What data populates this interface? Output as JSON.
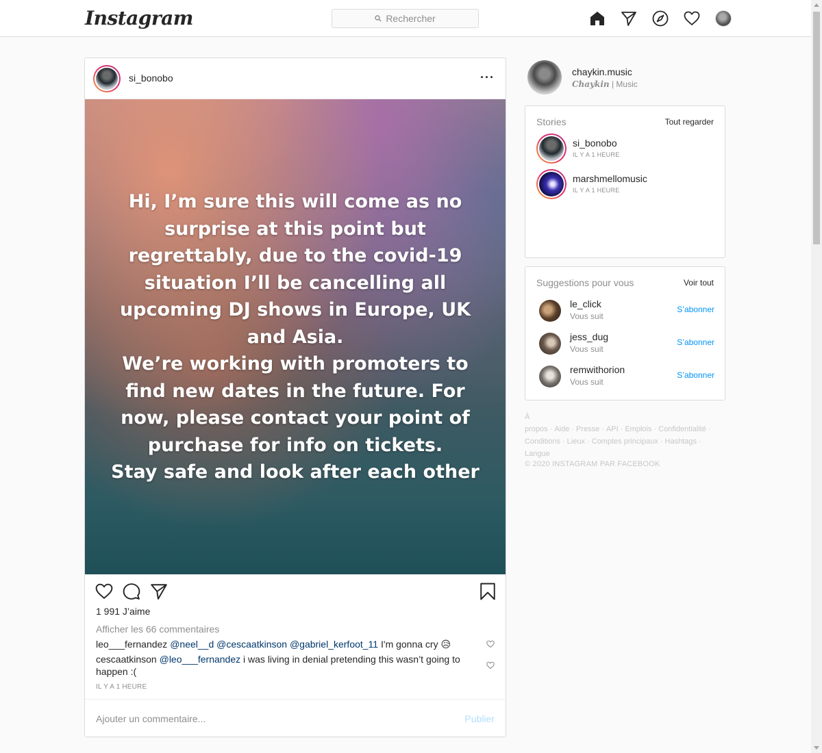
{
  "nav": {
    "logo": "Instagram",
    "search_placeholder": "Rechercher",
    "icons": [
      "home-icon",
      "direct-icon",
      "explore-icon",
      "activity-heart-icon",
      "profile-avatar"
    ]
  },
  "post": {
    "username": "si_bonobo",
    "image_text": "Hi, I’m sure this will come as no\nsurprise at this point but\nregrettably, due to the covid-19\nsituation I’ll be cancelling all\nupcoming DJ shows in Europe, UK\nand Asia.\nWe’re working with promoters to\nfind new dates in the future. For\nnow, please contact your point of\npurchase for info on tickets.\nStay safe and look after each other",
    "likes": "1 991 J’aime",
    "view_comments": "Afficher les 66 commentaires",
    "comments": [
      {
        "user": "leo___fernandez",
        "mentions": "@neel__d @cescaatkinson @gabriel_kerfoot_11",
        "text": "I'm gonna cry 😥"
      },
      {
        "user": "cescaatkinson",
        "mentions": "@leo___fernandez",
        "text": "i was living in denial pretending this wasn’t going to happen :("
      }
    ],
    "time": "IL Y A 1 HEURE",
    "add_comment_placeholder": "Ajouter un commentaire...",
    "publish_label": "Publier"
  },
  "me": {
    "username": "chaykin.music",
    "full_name": "Chaykin",
    "bio_suffix": " | Music"
  },
  "stories": {
    "title": "Stories",
    "see_all": "Tout regarder",
    "items": [
      {
        "user": "si_bonobo",
        "time": "IL Y A 1 HEURE"
      },
      {
        "user": "marshmellomusic",
        "time": "IL Y A 1 HEURE"
      }
    ]
  },
  "suggestions": {
    "title": "Suggestions pour vous",
    "see_all": "Voir tout",
    "items": [
      {
        "user": "le_click",
        "sub": "Vous suit",
        "action": "S’abonner"
      },
      {
        "user": "jess_dug",
        "sub": "Vous suit",
        "action": "S’abonner"
      },
      {
        "user": "remwithorion",
        "sub": "Vous suit",
        "action": "S’abonner"
      }
    ]
  },
  "footer": {
    "links": [
      "À propos",
      "Aide",
      "Presse",
      "API",
      "Emplois",
      "Confidentialité",
      "Conditions",
      "Lieux",
      "Comptes principaux",
      "Hashtags",
      "Langue"
    ],
    "copyright": "© 2020 INSTAGRAM PAR FACEBOOK"
  },
  "colors": {
    "link_blue": "#0095f6",
    "publish_disabled": "#b2dffc",
    "mention": "#00376b",
    "border": "#dbdbdb"
  }
}
